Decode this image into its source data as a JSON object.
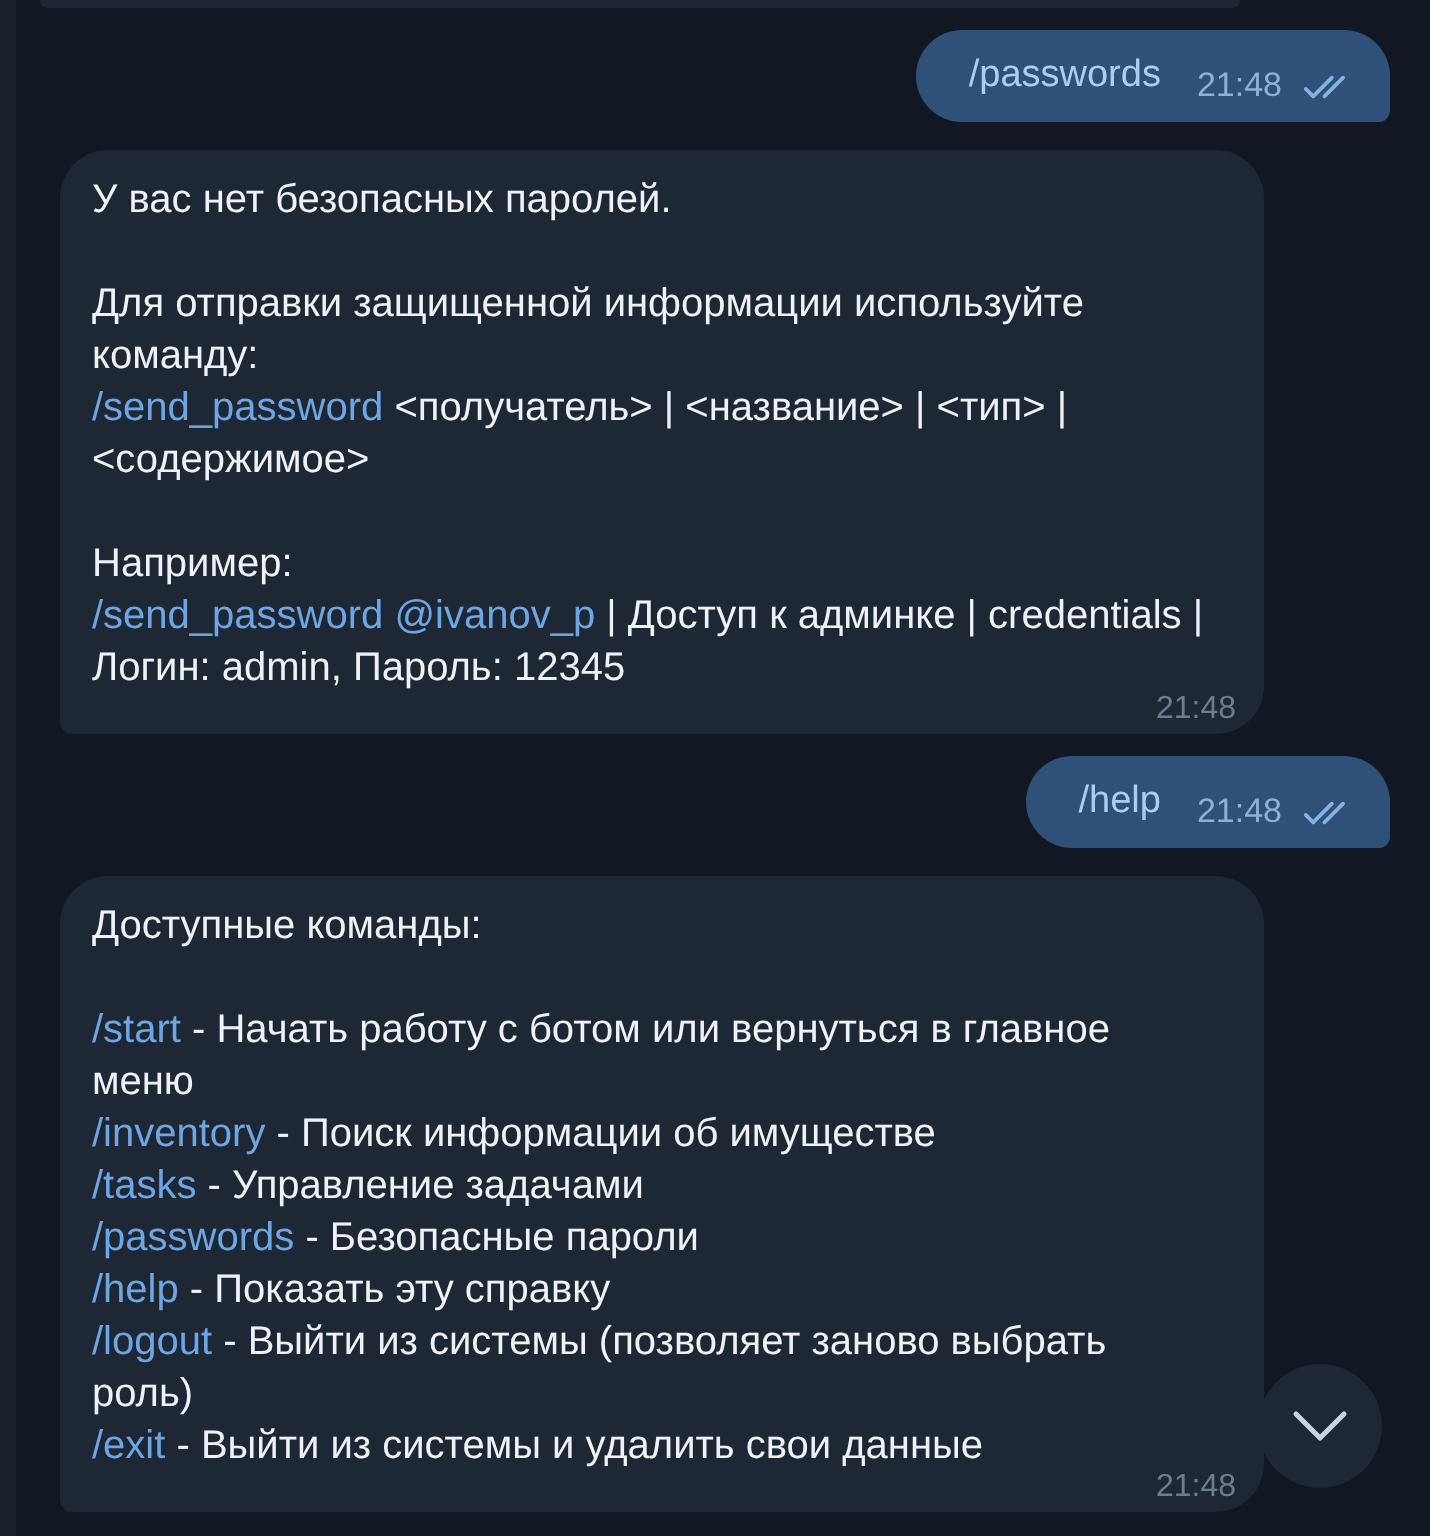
{
  "messages": [
    {
      "kind": "partial"
    },
    {
      "kind": "outgoing",
      "text": "/passwords",
      "time": "21:48",
      "read": true
    },
    {
      "kind": "incoming",
      "time": "21:48",
      "blocks": [
        [
          [
            {
              "kind": "text",
              "text": "У вас нет безопасных паролей."
            }
          ]
        ],
        [
          [
            {
              "kind": "text",
              "text": "Для отправки защищенной информации используйте команду:"
            }
          ],
          [
            {
              "kind": "command",
              "text": "/send_password"
            },
            {
              "kind": "text",
              "text": " <получатель> | <название> | <тип> | <содержимое>"
            }
          ]
        ],
        [
          [
            {
              "kind": "text",
              "text": "Например:"
            }
          ],
          [
            {
              "kind": "command",
              "text": "/send_password"
            },
            {
              "kind": "mention",
              "text": "@ivanov_p"
            },
            {
              "kind": "text",
              "text": " | Доступ к админке | credentials | Логин: admin, Пароль: 12345"
            }
          ]
        ]
      ]
    },
    {
      "kind": "outgoing",
      "text": "/help",
      "time": "21:48",
      "read": true
    },
    {
      "kind": "incoming",
      "time": "21:48",
      "blocks": [
        [
          [
            {
              "kind": "text",
              "text": "Доступные команды:"
            }
          ]
        ],
        [
          [
            {
              "kind": "command",
              "text": "/start"
            },
            {
              "kind": "text",
              "text": " - Начать работу с ботом или вернуться в главное меню"
            }
          ],
          [
            {
              "kind": "command",
              "text": "/inventory"
            },
            {
              "kind": "text",
              "text": " - Поиск информации об имуществе"
            }
          ],
          [
            {
              "kind": "command",
              "text": "/tasks"
            },
            {
              "kind": "text",
              "text": " - Управление задачами"
            }
          ],
          [
            {
              "kind": "command",
              "text": "/passwords"
            },
            {
              "kind": "text",
              "text": " - Безопасные пароли"
            }
          ],
          [
            {
              "kind": "command",
              "text": "/help"
            },
            {
              "kind": "text",
              "text": " - Показать эту справку"
            }
          ],
          [
            {
              "kind": "command",
              "text": "/logout"
            },
            {
              "kind": "text",
              "text": " - Выйти из системы (позволяет заново выбрать роль)"
            }
          ],
          [
            {
              "kind": "command",
              "text": "/exit"
            },
            {
              "kind": "text",
              "text": " - Выйти из системы и удалить свои данные"
            }
          ]
        ]
      ]
    }
  ]
}
